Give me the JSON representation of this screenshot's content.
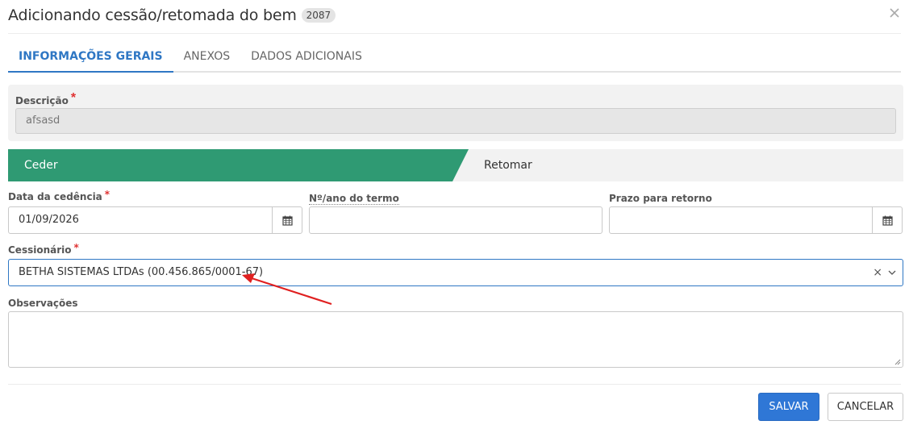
{
  "header": {
    "title": "Adicionando cessão/retomada do bem",
    "badge": "2087",
    "close_icon": "close-icon"
  },
  "tabs": [
    {
      "label": "INFORMAÇÕES GERAIS",
      "active": true
    },
    {
      "label": "ANEXOS",
      "active": false
    },
    {
      "label": "DADOS ADICIONAIS",
      "active": false
    }
  ],
  "descricao": {
    "label": "Descrição",
    "required_mark": "*",
    "value": "afsasd"
  },
  "steps": {
    "ceder": "Ceder",
    "retomar": "Retomar",
    "active_color": "#2f9a73"
  },
  "fields": {
    "data_cedencia": {
      "label": "Data da cedência",
      "required_mark": "*",
      "value": "01/09/2026"
    },
    "numero_termo": {
      "label": "Nº/ano do termo",
      "value": ""
    },
    "prazo_retorno": {
      "label": "Prazo para retorno",
      "value": ""
    },
    "cessionario": {
      "label": "Cessionário",
      "required_mark": "*",
      "value": "BETHA SISTEMAS LTDAs (00.456.865/0001-67)",
      "clear_symbol": "×"
    },
    "observacoes": {
      "label": "Observações",
      "value": ""
    }
  },
  "footer": {
    "save_label": "SALVAR",
    "cancel_label": "CANCELAR",
    "save_color": "#2f77d6"
  },
  "annotation": {
    "color": "#e02020"
  }
}
